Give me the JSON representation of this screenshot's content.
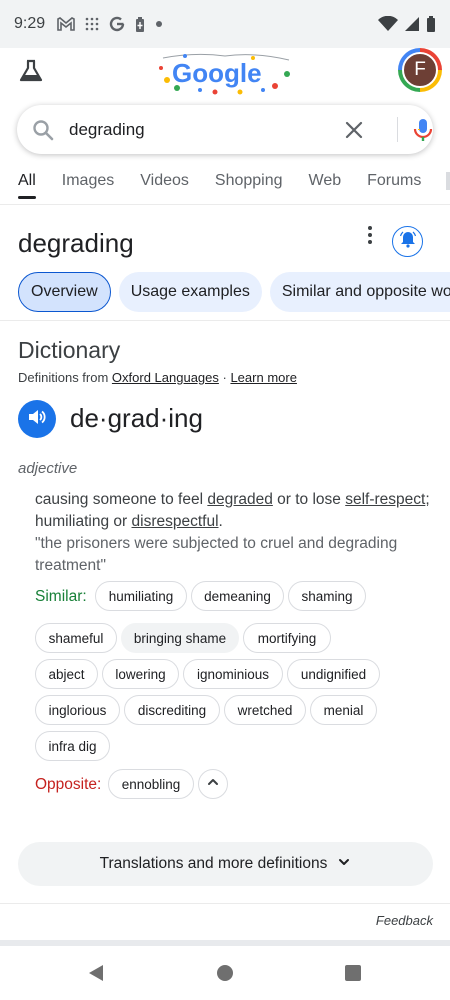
{
  "status_bar": {
    "time": "9:29",
    "left_icons": [
      "gmail-icon",
      "grid-dots-icon",
      "google-g-icon",
      "battery-saver-icon",
      "dot-icon"
    ],
    "right_icons": [
      "wifi-icon",
      "cell-signal-icon",
      "battery-icon"
    ]
  },
  "header": {
    "logo_text": "Google",
    "avatar_letter": "F"
  },
  "search": {
    "query": "degrading"
  },
  "tabs": [
    {
      "label": "All",
      "active": true
    },
    {
      "label": "Images"
    },
    {
      "label": "Videos"
    },
    {
      "label": "Shopping"
    },
    {
      "label": "Web"
    },
    {
      "label": "Forums"
    }
  ],
  "result": {
    "term": "degrading",
    "chips": [
      "Overview",
      "Usage examples",
      "Similar and opposite words"
    ]
  },
  "dictionary": {
    "title": "Dictionary",
    "defs_from_prefix": "Definitions from ",
    "source": "Oxford Languages",
    "separator": " · ",
    "learn_more": "Learn more",
    "pronunciation": "de·grad·ing",
    "part_of_speech": "adjective",
    "definition": {
      "t1": "causing someone to feel ",
      "l1": "degraded",
      "t2": " or to lose ",
      "l2": "self-respect",
      "t3": "; humiliating or ",
      "l3": "disrespectful",
      "t4": "."
    },
    "example": "\"the prisoners were subjected to cruel and degrading treatment\"",
    "similar_label": "Similar:",
    "similar": [
      "humiliating",
      "demeaning",
      "shaming",
      "shameful",
      "bringing shame",
      "mortifying",
      "abject",
      "lowering",
      "ignominious",
      "undignified",
      "inglorious",
      "discrediting",
      "wretched",
      "menial",
      "infra dig"
    ],
    "opposite_label": "Opposite:",
    "opposite": [
      "ennobling"
    ]
  },
  "translations_button": "Translations and more definitions",
  "feedback": "Feedback",
  "colors": {
    "accent_blue": "#1a73e8",
    "similar_green": "#188038",
    "opposite_red": "#c5221f",
    "chip_blue": "#e8f0fe"
  }
}
